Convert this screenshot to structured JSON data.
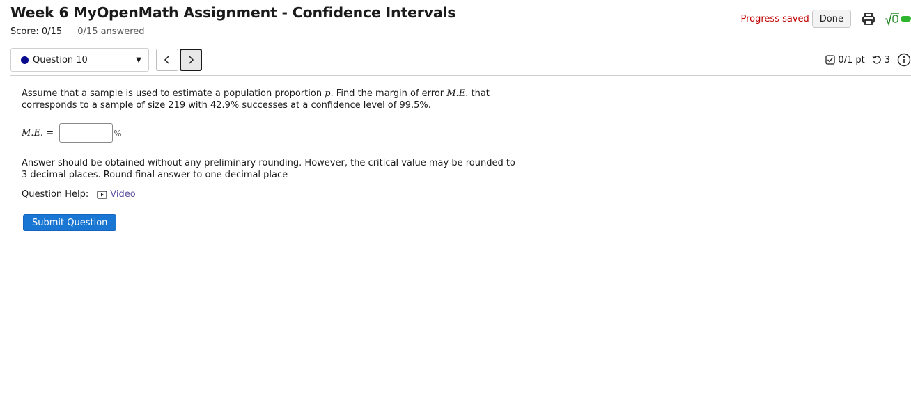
{
  "header": {
    "title": "Week 6 MyOpenMath Assignment - Confidence Intervals",
    "score": "Score: 0/15",
    "answered": "0/15 answered",
    "progress_status": "Progress saved",
    "done_label": "Done"
  },
  "nav": {
    "question_select": "Question 10",
    "prev_icon": "chevron-left-icon",
    "next_icon": "chevron-right-icon"
  },
  "question_info": {
    "points": "0/1 pt",
    "attempts": "3"
  },
  "question": {
    "text_a": "Assume that a sample is used to estimate a population proportion ",
    "var_p": "p",
    "text_b": ". Find the margin of error ",
    "var_me": "M.E.",
    "text_c": " that corresponds to a sample of size 219 with 42.9% successes at a confidence level of 99.5%.",
    "me_label": "M.E.",
    "equals": " =",
    "me_value": "",
    "unit": "%",
    "note": "Answer should be obtained without any preliminary rounding. However, the critical value may be rounded to 3 decimal places. Round final answer to one decimal place",
    "help_label": "Question Help:",
    "video_label": "Video",
    "submit_label": "Submit Question"
  },
  "colors": {
    "accent": "#1976d2",
    "progress_text": "#c00000",
    "status_dot": "#0a0a8c",
    "video_link": "#5d4f9e"
  }
}
